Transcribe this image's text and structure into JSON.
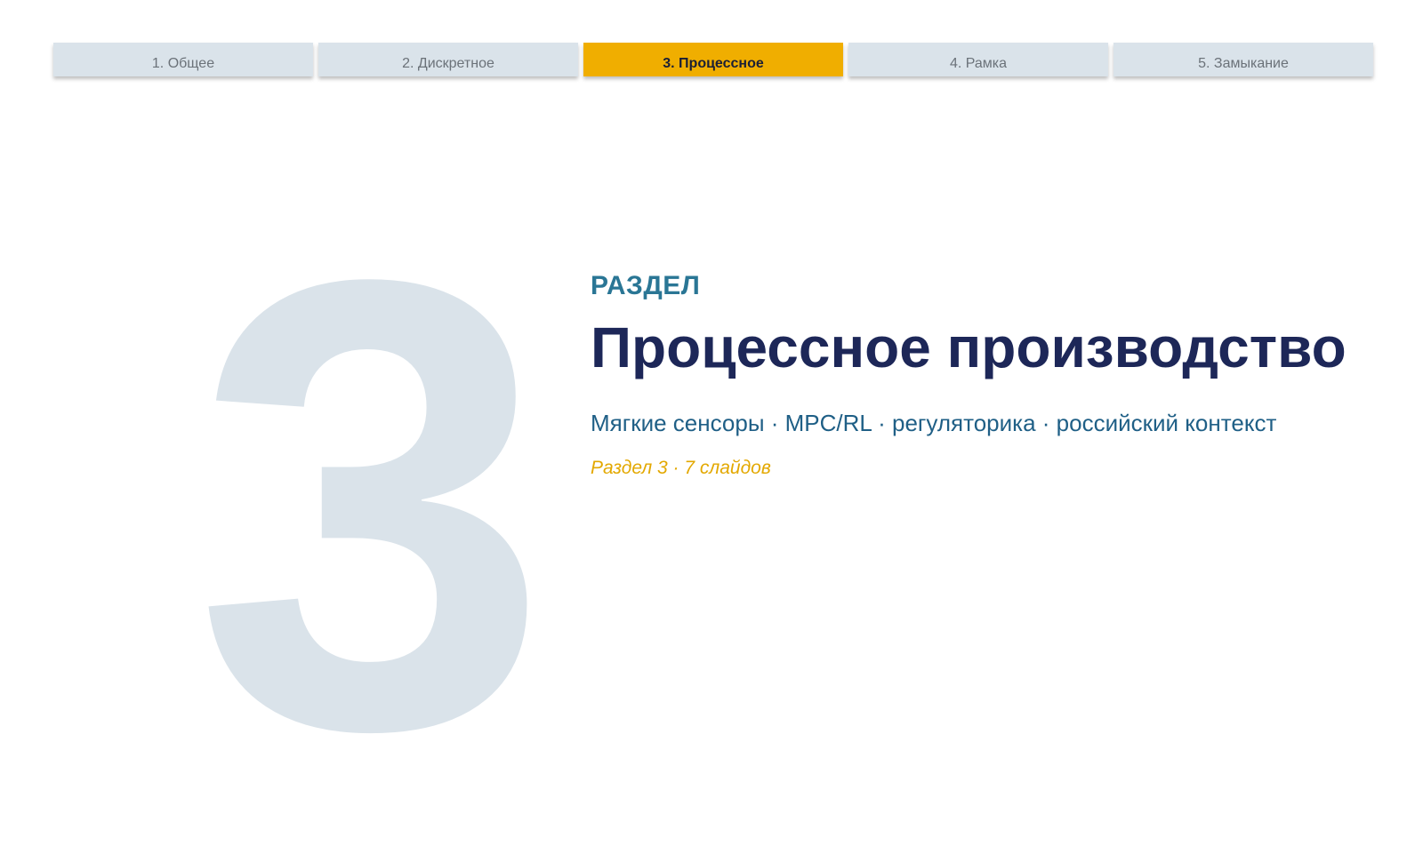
{
  "nav": {
    "tabs": [
      {
        "label": "1. Общее",
        "active": false
      },
      {
        "label": "2. Дискретное",
        "active": false
      },
      {
        "label": "3. Процессное",
        "active": true
      },
      {
        "label": "4. Рамка",
        "active": false
      },
      {
        "label": "5. Замыкание",
        "active": false
      }
    ]
  },
  "section": {
    "number": "3",
    "eyebrow": "РАЗДЕЛ",
    "title": "Процессное производство",
    "subtitle": "Мягкие сенсоры · MPC/RL · регуляторика · российский контекст",
    "meta": "Раздел 3 · 7 слайдов"
  },
  "colors": {
    "accent": "#f0ae00",
    "tab_bg": "#dae3ea",
    "title": "#1d2758",
    "eyebrow": "#2a7695",
    "subtitle": "#1f5f86",
    "meta": "#e3a800",
    "watermark_number": "#dae3ea"
  }
}
